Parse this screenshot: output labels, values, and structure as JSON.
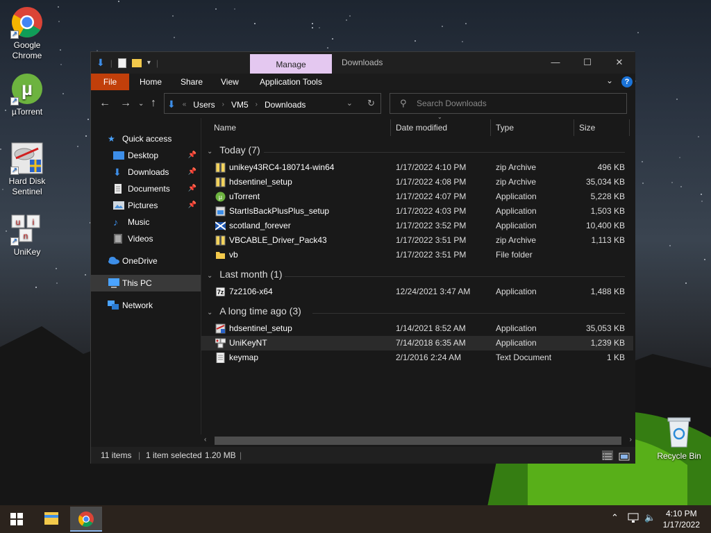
{
  "desktop": {
    "icons": [
      {
        "label": "Google Chrome",
        "icon": "chrome-icon"
      },
      {
        "label": "µTorrent",
        "icon": "utorrent-icon"
      },
      {
        "label": "Hard Disk Sentinel",
        "icon": "hard-disk-sentinel-icon"
      },
      {
        "label": "UniKey",
        "icon": "unikey-icon"
      }
    ],
    "recycle_bin": "Recycle Bin"
  },
  "window": {
    "manage_tab": "Manage",
    "title": "Downloads",
    "ribbon_tabs": [
      "File",
      "Home",
      "Share",
      "View",
      "Application Tools"
    ],
    "accent_file_tab": "#c13f0a",
    "manage_tab_color": "#e4c8f0"
  },
  "address": {
    "crumbs": [
      "Users",
      "VM5",
      "Downloads"
    ]
  },
  "search": {
    "placeholder": "Search Downloads"
  },
  "sidebar": {
    "items": [
      {
        "label": "Quick access",
        "icon": "star-icon"
      },
      {
        "label": "Desktop",
        "icon": "desktop-folder-icon",
        "pinned": true
      },
      {
        "label": "Downloads",
        "icon": "downloads-folder-icon",
        "pinned": true
      },
      {
        "label": "Documents",
        "icon": "documents-folder-icon",
        "pinned": true
      },
      {
        "label": "Pictures",
        "icon": "pictures-folder-icon",
        "pinned": true
      },
      {
        "label": "Music",
        "icon": "music-icon"
      },
      {
        "label": "Videos",
        "icon": "videos-icon"
      },
      {
        "label": "OneDrive",
        "icon": "onedrive-icon"
      },
      {
        "label": "This PC",
        "icon": "this-pc-icon",
        "selected": true
      },
      {
        "label": "Network",
        "icon": "network-icon"
      }
    ]
  },
  "columns": {
    "name": "Name",
    "date": "Date modified",
    "type": "Type",
    "size": "Size"
  },
  "groups": [
    {
      "header": "Today (7)",
      "files": [
        {
          "name": "unikey43RC4-180714-win64",
          "date": "1/17/2022 4:10 PM",
          "type": "zip Archive",
          "size": "496 KB",
          "icon": "zip-icon"
        },
        {
          "name": "hdsentinel_setup",
          "date": "1/17/2022 4:08 PM",
          "type": "zip Archive",
          "size": "35,034 KB",
          "icon": "zip-icon"
        },
        {
          "name": "uTorrent",
          "date": "1/17/2022 4:07 PM",
          "type": "Application",
          "size": "5,228 KB",
          "icon": "utorrent-app-icon"
        },
        {
          "name": "StartIsBackPlusPlus_setup",
          "date": "1/17/2022 4:03 PM",
          "type": "Application",
          "size": "1,503 KB",
          "icon": "setup-app-icon"
        },
        {
          "name": "scotland_forever",
          "date": "1/17/2022 3:52 PM",
          "type": "Application",
          "size": "10,400 KB",
          "icon": "scotland-flag-icon"
        },
        {
          "name": "VBCABLE_Driver_Pack43",
          "date": "1/17/2022 3:51 PM",
          "type": "zip Archive",
          "size": "1,113 KB",
          "icon": "zip-icon"
        },
        {
          "name": "vb",
          "date": "1/17/2022 3:51 PM",
          "type": "File folder",
          "size": "",
          "icon": "folder-icon"
        }
      ]
    },
    {
      "header": "Last month (1)",
      "files": [
        {
          "name": "7z2106-x64",
          "date": "12/24/2021 3:47 AM",
          "type": "Application",
          "size": "1,488 KB",
          "icon": "7zip-icon"
        }
      ]
    },
    {
      "header": "A long time ago (3)",
      "files": [
        {
          "name": "hdsentinel_setup",
          "date": "1/14/2021 8:52 AM",
          "type": "Application",
          "size": "35,053 KB",
          "icon": "hdsentinel-app-icon"
        },
        {
          "name": "UniKeyNT",
          "date": "7/14/2018 6:35 AM",
          "type": "Application",
          "size": "1,239 KB",
          "icon": "unikey-app-icon",
          "selected": true
        },
        {
          "name": "keymap",
          "date": "2/1/2016 2:24 AM",
          "type": "Text Document",
          "size": "1 KB",
          "icon": "text-file-icon"
        }
      ]
    }
  ],
  "status": {
    "items": "11 items",
    "selected": "1 item selected",
    "size": "1.20 MB"
  },
  "taskbar": {
    "time": "4:10 PM",
    "date": "1/17/2022"
  }
}
